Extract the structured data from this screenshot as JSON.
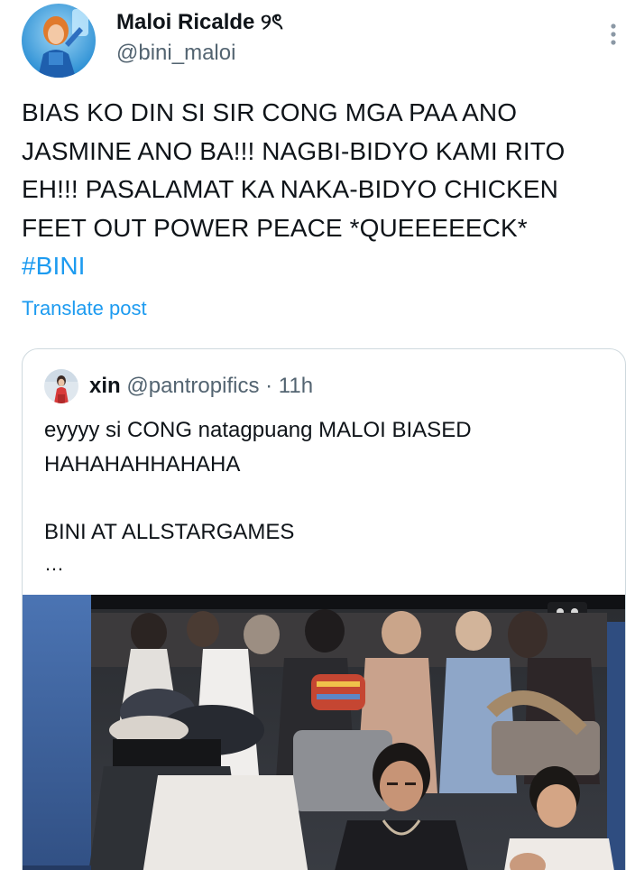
{
  "post": {
    "author_name": "Maloi Ricalde",
    "author_emoji": "୨ৎ",
    "handle": "@bini_maloi",
    "text_lines": [
      "BIAS KO DIN SI SIR CONG MGA PAA ANO",
      "JASMINE ANO BA!!! NAGBI-BIDYO KAMI RITO",
      "EH!!! PASALAMAT KA NAKA-BIDYO CHICKEN",
      "FEET OUT POWER PEACE *QUEEEEECK*"
    ],
    "hashtag": "#BINI",
    "translate_label": "Translate post"
  },
  "quote": {
    "author_name": "xin",
    "handle": "@pantropifics",
    "separator": "·",
    "time": "11h",
    "text_lines": [
      "eyyyy si CONG natagpuang MALOI BIASED",
      "HAHAHAHHAHAHA",
      "",
      "BINI AT ALLSTARGAMES"
    ],
    "ellipsis": "…"
  },
  "icons": {
    "more": "more-vertical-icon",
    "avatar": "profile-avatar",
    "media": "video-thumbnail"
  },
  "colors": {
    "link": "#1d9bf0",
    "secondary_text": "#536471",
    "border": "#cfd9de"
  }
}
